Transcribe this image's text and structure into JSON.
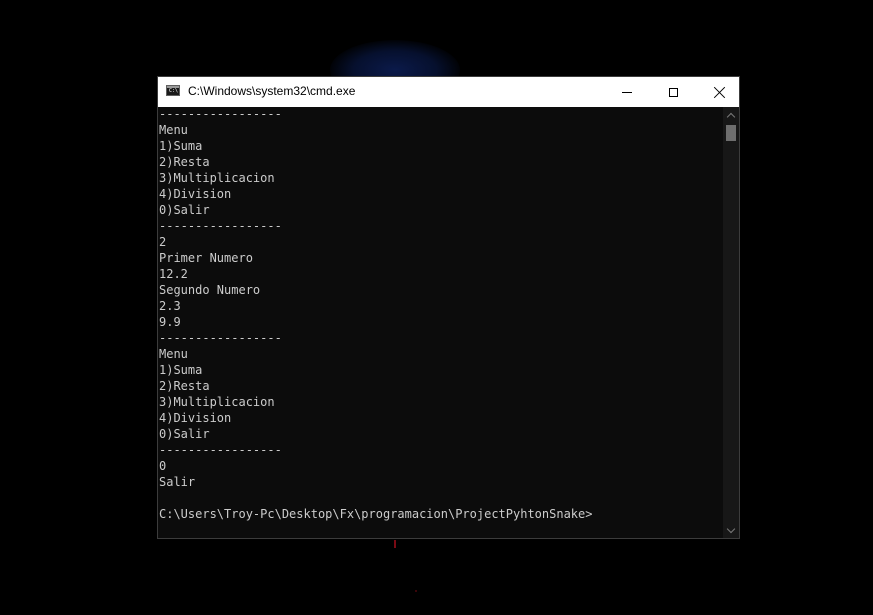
{
  "window": {
    "title": "C:\\Windows\\system32\\cmd.exe",
    "icon": "cmd-icon",
    "controls": {
      "minimize_icon": "minimize-icon",
      "maximize_icon": "maximize-icon",
      "close_icon": "close-icon"
    }
  },
  "console": {
    "lines": [
      "-----------------",
      "Menu",
      "1)Suma",
      "2)Resta",
      "3)Multiplicacion",
      "4)Division",
      "0)Salir",
      "-----------------",
      "2",
      "Primer Numero",
      "12.2",
      "Segundo Numero",
      "2.3",
      "9.9",
      "-----------------",
      "Menu",
      "1)Suma",
      "2)Resta",
      "3)Multiplicacion",
      "4)Division",
      "0)Salir",
      "-----------------",
      "0",
      "Salir",
      "",
      "C:\\Users\\Troy-Pc\\Desktop\\Fx\\programacion\\ProjectPyhtonSnake>"
    ]
  },
  "colors": {
    "console_background": "#0c0c0c",
    "console_text": "#cccccc",
    "titlebar": "#ffffff"
  }
}
